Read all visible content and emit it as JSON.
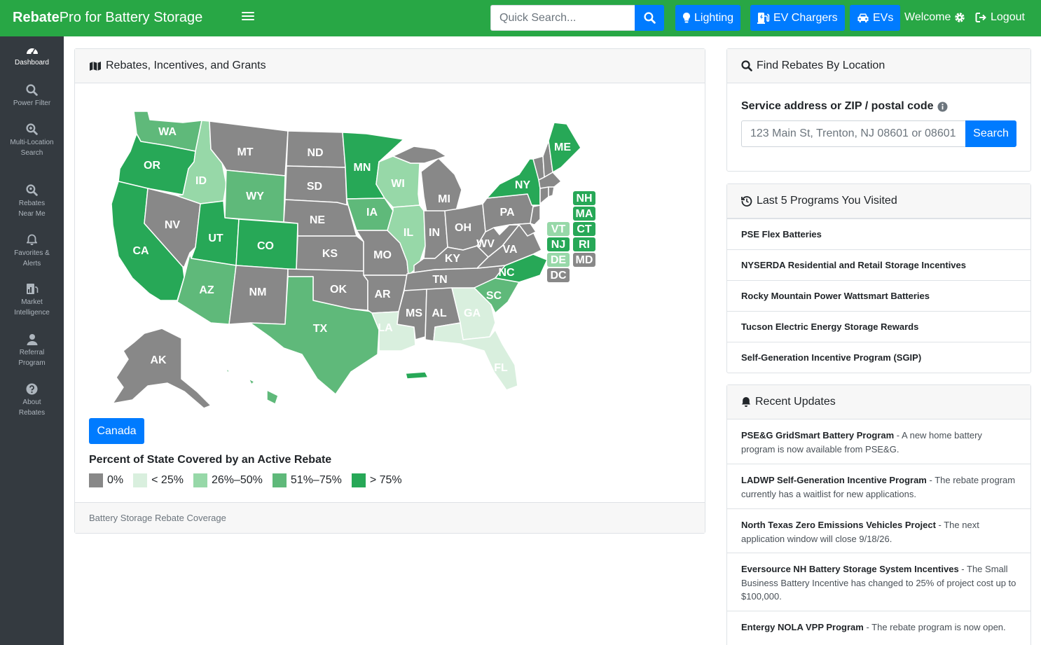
{
  "topbar": {
    "brand_bold": "Rebate",
    "brand_rest": "Pro for Battery Storage",
    "search_placeholder": "Quick Search...",
    "nav": {
      "lighting": "Lighting",
      "ev_chargers": "EV Chargers",
      "evs": "EVs"
    },
    "welcome": "Welcome",
    "logout": "Logout"
  },
  "sidebar": {
    "items": [
      {
        "label": "Dashboard",
        "icon": "tachometer-icon"
      },
      {
        "label": "Power Filter",
        "icon": "search-icon"
      },
      {
        "label": "Multi-Location Search",
        "icon": "search-plus-icon"
      },
      {
        "label": "Rebates Near Me",
        "icon": "search-location-icon"
      },
      {
        "label": "Favorites & Alerts",
        "icon": "bell-icon"
      },
      {
        "label": "Market Intelligence",
        "icon": "chart-icon"
      },
      {
        "label": "Referral Program",
        "icon": "user-icon"
      },
      {
        "label": "About Rebates",
        "icon": "question-circle-icon"
      }
    ]
  },
  "map_card": {
    "title": "Rebates, Incentives, and Grants",
    "canada_button": "Canada",
    "legend_title": "Percent of State Covered by an Active Rebate",
    "legend": [
      {
        "label": "0%",
        "color": "#888888"
      },
      {
        "label": "< 25%",
        "color": "#d9efde"
      },
      {
        "label": "26%–50%",
        "color": "#97d8a8"
      },
      {
        "label": "51%–75%",
        "color": "#5fb97a"
      },
      {
        "label": "> 75%",
        "color": "#27a857"
      }
    ],
    "footer": "Battery Storage Rebate Coverage",
    "states": [
      {
        "code": "WA",
        "level": 3
      },
      {
        "code": "OR",
        "level": 4
      },
      {
        "code": "CA",
        "level": 4
      },
      {
        "code": "ID",
        "level": 2
      },
      {
        "code": "NV",
        "level": 0
      },
      {
        "code": "MT",
        "level": 0
      },
      {
        "code": "WY",
        "level": 3
      },
      {
        "code": "UT",
        "level": 4
      },
      {
        "code": "AZ",
        "level": 3
      },
      {
        "code": "CO",
        "level": 4
      },
      {
        "code": "NM",
        "level": 0
      },
      {
        "code": "ND",
        "level": 0
      },
      {
        "code": "SD",
        "level": 0
      },
      {
        "code": "NE",
        "level": 0
      },
      {
        "code": "KS",
        "level": 0
      },
      {
        "code": "OK",
        "level": 0
      },
      {
        "code": "TX",
        "level": 3
      },
      {
        "code": "MN",
        "level": 4
      },
      {
        "code": "IA",
        "level": 3
      },
      {
        "code": "MO",
        "level": 0
      },
      {
        "code": "AR",
        "level": 0
      },
      {
        "code": "LA",
        "level": 1
      },
      {
        "code": "WI",
        "level": 2
      },
      {
        "code": "IL",
        "level": 2
      },
      {
        "code": "MI",
        "level": 0
      },
      {
        "code": "IN",
        "level": 0
      },
      {
        "code": "OH",
        "level": 0
      },
      {
        "code": "KY",
        "level": 0
      },
      {
        "code": "TN",
        "level": 0
      },
      {
        "code": "MS",
        "level": 0
      },
      {
        "code": "AL",
        "level": 0
      },
      {
        "code": "GA",
        "level": 1
      },
      {
        "code": "FL",
        "level": 1
      },
      {
        "code": "SC",
        "level": 3
      },
      {
        "code": "NC",
        "level": 4
      },
      {
        "code": "VA",
        "level": 0
      },
      {
        "code": "WV",
        "level": 0
      },
      {
        "code": "PA",
        "level": 0
      },
      {
        "code": "NY",
        "level": 4
      },
      {
        "code": "ME",
        "level": 4
      },
      {
        "code": "AK",
        "level": 0
      },
      {
        "code": "HI",
        "level": 3
      },
      {
        "code": "PR",
        "level": 4
      }
    ],
    "ne_boxes": [
      {
        "code": "NH",
        "level": 4
      },
      {
        "code": "MA",
        "level": 4
      },
      {
        "code": "VT",
        "level": 2
      },
      {
        "code": "CT",
        "level": 4
      },
      {
        "code": "NJ",
        "level": 4
      },
      {
        "code": "RI",
        "level": 4
      },
      {
        "code": "DE",
        "level": 2
      },
      {
        "code": "MD",
        "level": 0
      },
      {
        "code": "DC",
        "level": 0
      }
    ]
  },
  "find_card": {
    "title": "Find Rebates By Location",
    "label": "Service address or ZIP / postal code",
    "placeholder": "123 Main St, Trenton, NJ 08601 or 08601",
    "button": "Search"
  },
  "last_card": {
    "title": "Last 5 Programs You Visited",
    "items": [
      "PSE Flex Batteries",
      "NYSERDA Residential and Retail Storage Incentives",
      "Rocky Mountain Power Wattsmart Batteries",
      "Tucson Electric Energy Storage Rewards",
      "Self-Generation Incentive Program (SGIP)"
    ]
  },
  "updates_card": {
    "title": "Recent Updates",
    "items": [
      {
        "program": "PSE&G GridSmart Battery Program",
        "text": " - A new home battery program is now available from PSE&G."
      },
      {
        "program": "LADWP Self-Generation Incentive Program",
        "text": " - The rebate program currently has a waitlist for new applications."
      },
      {
        "program": "North Texas Zero Emissions Vehicles Project",
        "text": " - The next application window will close 9/18/26."
      },
      {
        "program": "Eversource NH Battery Storage System Incentives",
        "text": " - The Small Business Battery Incentive has changed to 25% of project cost up to $100,000."
      },
      {
        "program": "Entergy NOLA VPP Program",
        "text": " - The rebate program is now open."
      }
    ]
  }
}
